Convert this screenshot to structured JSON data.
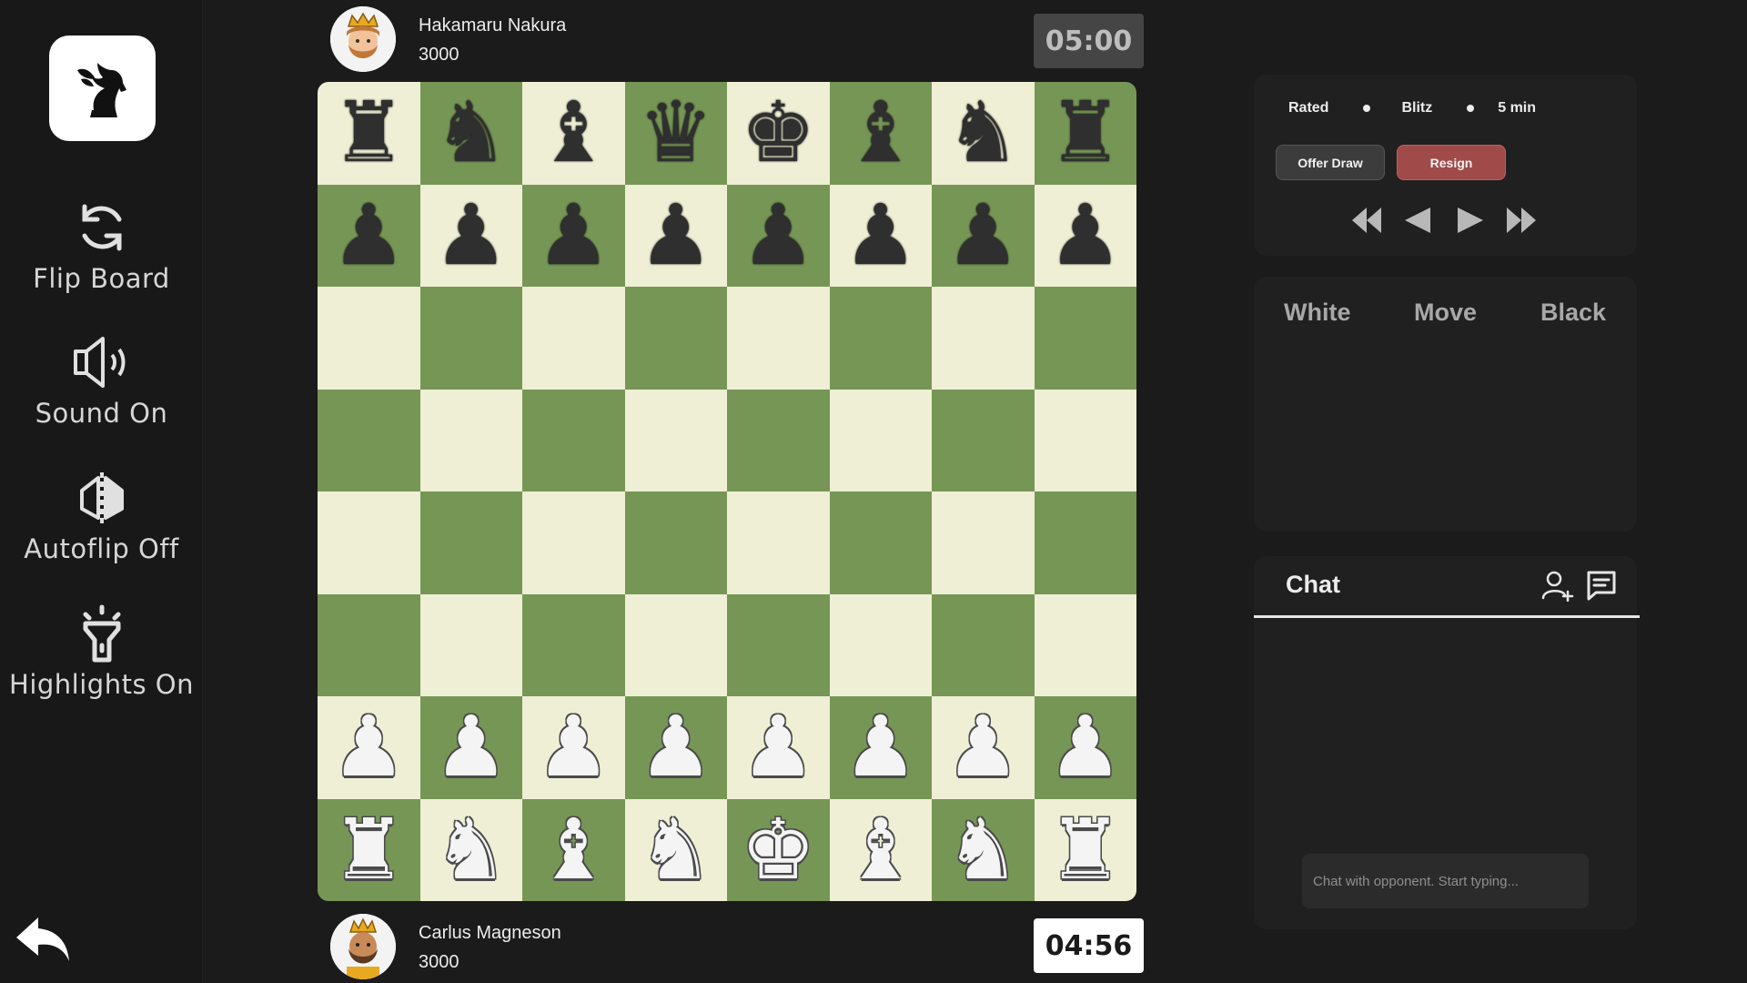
{
  "sidebar": {
    "items": [
      {
        "label": "Flip Board",
        "icon": "flip-icon"
      },
      {
        "label": "Sound On",
        "icon": "speaker-icon"
      },
      {
        "label": "Autoflip Off",
        "icon": "autoflip-icon"
      },
      {
        "label": "Highlights On",
        "icon": "flashlight-icon"
      }
    ]
  },
  "players": {
    "top": {
      "name": "Hakamaru Nakura",
      "rating": "3000",
      "clock": "05:00"
    },
    "bottom": {
      "name": "Carlus Magneson",
      "rating": "3000",
      "clock": "04:56"
    }
  },
  "game": {
    "tags": [
      "Rated",
      "Blitz",
      "5 min"
    ],
    "offer_draw": "Offer Draw",
    "resign": "Resign"
  },
  "moves": {
    "headers": [
      "White",
      "Move",
      "Black"
    ]
  },
  "chat": {
    "title": "Chat",
    "placeholder": "Chat with opponent. Start typing..."
  },
  "colors": {
    "light_square": "#efefd5",
    "dark_square": "#769656",
    "resign": "#a04a4a"
  },
  "board": {
    "ranks": [
      [
        "r",
        "n",
        "b",
        "q",
        "k",
        "b",
        "n",
        "r"
      ],
      [
        "p",
        "p",
        "p",
        "p",
        "p",
        "p",
        "p",
        "p"
      ],
      [
        "",
        "",
        "",
        "",
        "",
        "",
        "",
        ""
      ],
      [
        "",
        "",
        "",
        "",
        "",
        "",
        "",
        ""
      ],
      [
        "",
        "",
        "",
        "",
        "",
        "",
        "",
        ""
      ],
      [
        "",
        "",
        "",
        "",
        "",
        "",
        "",
        ""
      ],
      [
        "P",
        "P",
        "P",
        "P",
        "P",
        "P",
        "P",
        "P"
      ],
      [
        "R",
        "N",
        "B",
        "N",
        "K",
        "B",
        "N",
        "R"
      ]
    ]
  }
}
